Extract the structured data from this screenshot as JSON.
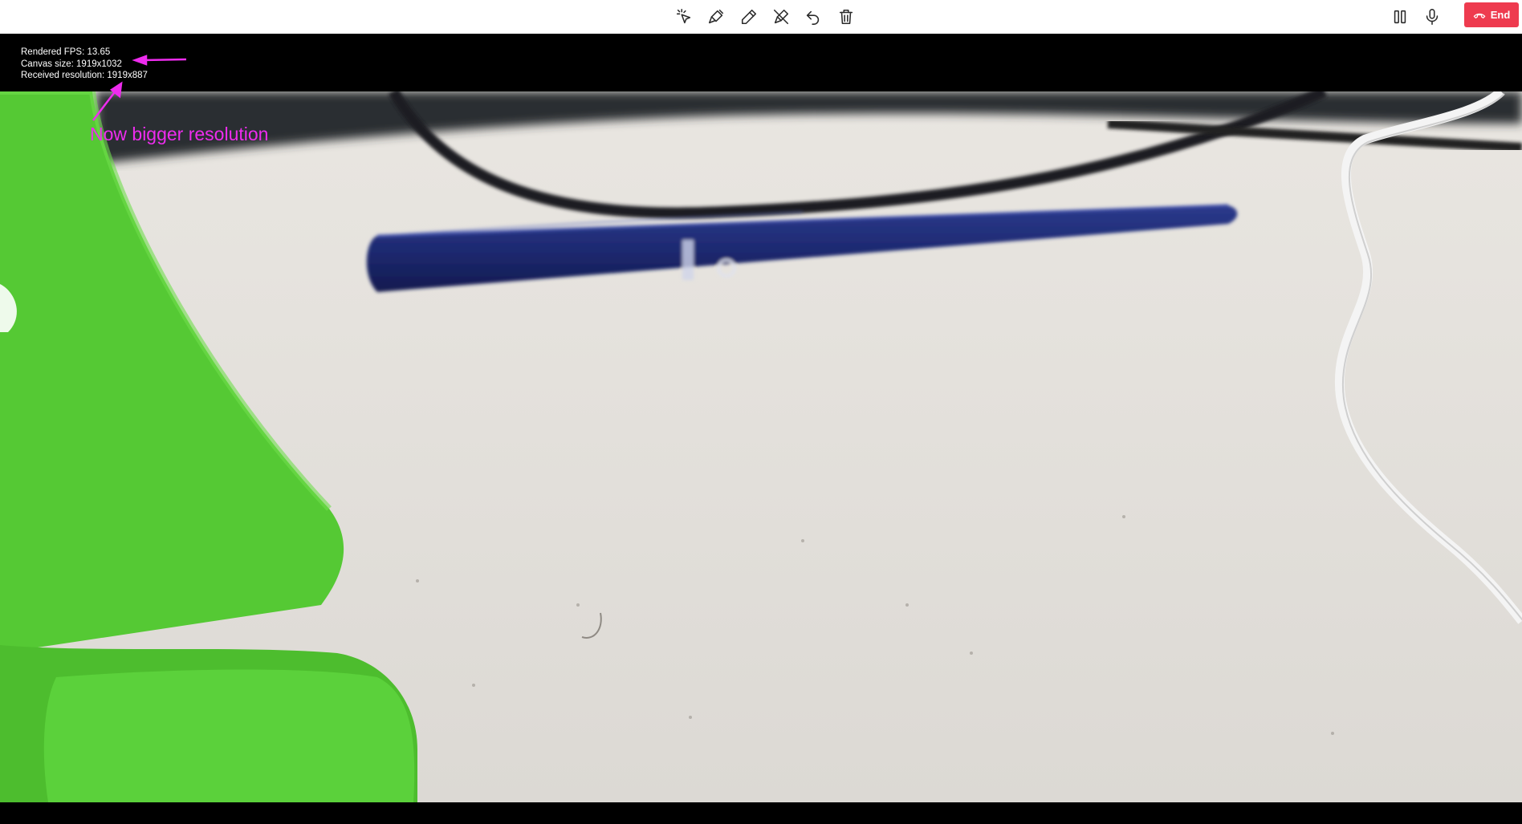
{
  "toolbar": {
    "tools": [
      {
        "name": "pointer-tool",
        "icon": "cursor-click-icon"
      },
      {
        "name": "draw-arrow-tool",
        "icon": "brush-icon"
      },
      {
        "name": "pen-tool",
        "icon": "pencil-icon"
      },
      {
        "name": "eraser-tool",
        "icon": "pen-off-icon"
      },
      {
        "name": "undo-tool",
        "icon": "undo-icon"
      },
      {
        "name": "delete-tool",
        "icon": "trash-icon"
      }
    ],
    "right": {
      "pause_icon": "pause-icon",
      "mic_icon": "microphone-icon",
      "end_label": "End",
      "end_icon": "phone-hangup-icon",
      "end_color": "#ee3b4f"
    }
  },
  "stats": {
    "fps": "Rendered FPS: 13.65",
    "canvas": "Canvas size: 1919x1032",
    "resolution": "Received resolution: 1919x887"
  },
  "annotation": {
    "text": "Now bigger resolution",
    "color": "#ee2cee"
  }
}
